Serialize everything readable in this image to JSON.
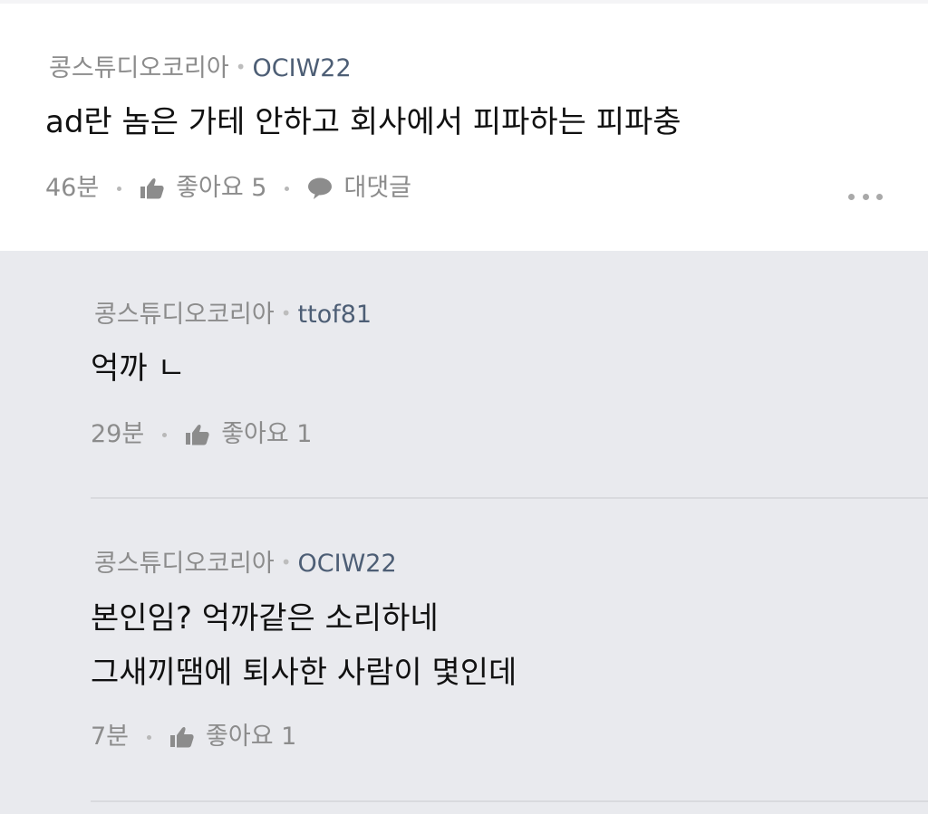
{
  "comment": {
    "source": "콩스튜디오코리아",
    "user": "OCIW22",
    "text": "ad란 놈은 가테 안하고 회사에서 피파하는 피파충",
    "time": "46분",
    "like_label": "좋아요 5",
    "reply_label": "대댓글",
    "icons": [
      "thumbs-up-icon",
      "speech-bubble-icon",
      "more-icon"
    ]
  },
  "replies": [
    {
      "source": "콩스튜디오코리아",
      "user": "ttof81",
      "lines": [
        "억까 ㄴ"
      ],
      "time": "29분",
      "like_label": "좋아요 1"
    },
    {
      "source": "콩스튜디오코리아",
      "user": "OCIW22",
      "lines": [
        "본인임? 억까같은 소리하네",
        "그새끼땜에 퇴사한 사람이 몇인데"
      ],
      "time": "7분",
      "like_label": "좋아요 1"
    }
  ],
  "colors": {
    "reply_background": "#e9eaee",
    "meta_text": "#8c8c8c",
    "user_text": "#4d5e75",
    "body_text": "#111111"
  }
}
